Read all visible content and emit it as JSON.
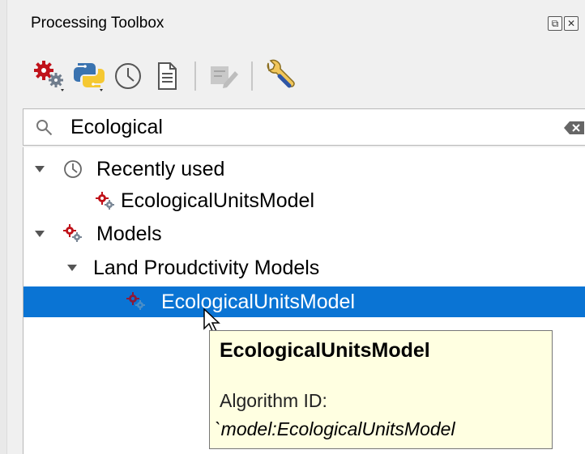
{
  "panel": {
    "title": "Processing Toolbox",
    "float_icon": "float-icon",
    "close_icon": "close-icon"
  },
  "toolbar": {
    "icons": [
      "models-gears-icon",
      "python-icon",
      "history-clock-icon",
      "results-document-icon",
      "edit-in-place-icon",
      "options-wrench-icon"
    ]
  },
  "search": {
    "value": "Ecological",
    "icon": "search-icon",
    "clear_icon": "clear-icon"
  },
  "tree": {
    "recent": {
      "label": "Recently used",
      "icon": "clock-icon"
    },
    "recent_item": {
      "label": "EcologicalUnitsModel",
      "icon": "model-gears-icon"
    },
    "models": {
      "label": "Models",
      "icon": "model-gears-icon"
    },
    "group": {
      "label": "Land Proudctivity Models"
    },
    "selected_item": {
      "label": "EcologicalUnitsModel",
      "icon": "model-gears-icon"
    }
  },
  "tooltip": {
    "title": "EcologicalUnitsModel",
    "line1": "Algorithm ID:",
    "line2": "`model:EcologicalUnitsModel"
  },
  "colors": {
    "selection": "#0a74d4",
    "tooltip_bg": "#ffffe1"
  }
}
